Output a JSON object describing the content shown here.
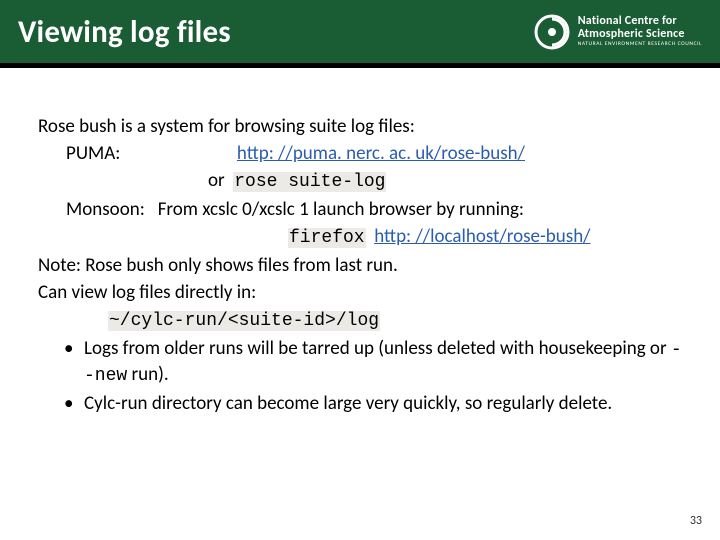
{
  "header": {
    "title": "Viewing log files",
    "logo": {
      "line1": "National Centre for",
      "line2": "Atmospheric Science",
      "sub": "NATURAL ENVIRONMENT RESEARCH COUNCIL"
    }
  },
  "body": {
    "intro": "Rose bush is a system for browsing suite log files:",
    "puma_label": "PUMA:",
    "puma_url": "http: //puma. nerc. ac. uk/rose-bush/",
    "or_label": "or",
    "or_cmd": "rose suite-log",
    "monsoon_label": "Monsoon:",
    "monsoon_text": "From xcslc 0/xcslc 1 launch browser by running:",
    "firefox_cmd": "firefox",
    "firefox_url": "http: //localhost/rose-bush/",
    "note": "Note: Rose bush only shows files from last run.",
    "view_direct": "Can view log files directly in:",
    "path": "~/cylc-run/<suite-id>/log",
    "bullet1a": "Logs from older runs will be tarred up (unless deleted with housekeeping or ",
    "bullet1_flag": "--new",
    "bullet1b": " run).",
    "bullet2": "Cylc-run directory can become large very quickly, so regularly delete."
  },
  "page": "33"
}
